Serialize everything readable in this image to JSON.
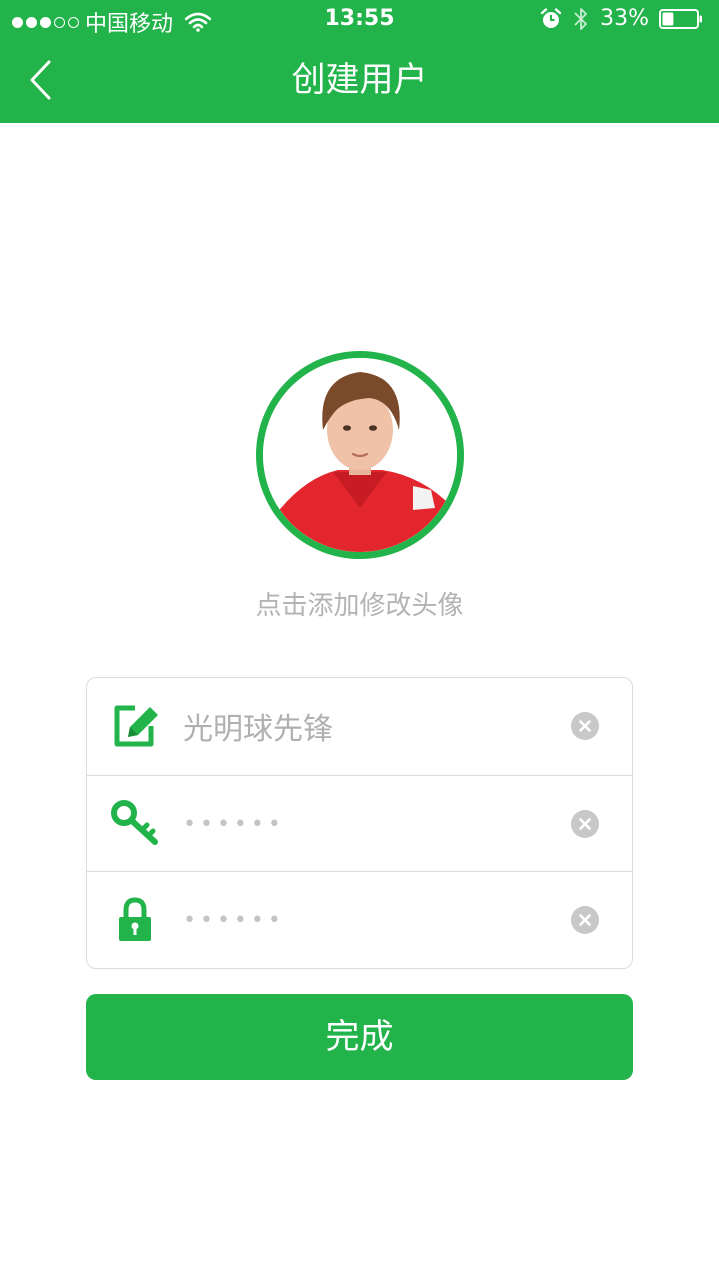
{
  "status_bar": {
    "signal_dots": [
      "full",
      "full",
      "full",
      "empty",
      "empty"
    ],
    "carrier": "中国移动",
    "time": "13:55",
    "battery": "33%",
    "battery_fraction": 0.33
  },
  "header": {
    "title": "创建用户",
    "background_color": "#22b34a"
  },
  "avatar": {
    "caption": "点击添加修改头像",
    "ring_color": "#22b34a"
  },
  "form": {
    "username_value": "光明球先锋",
    "password_value": "••••••",
    "confirm_password_value": "••••••"
  },
  "submit": {
    "label": "完成"
  },
  "icons": {
    "back": "chevron-left-icon",
    "username": "edit-icon",
    "password": "key-icon",
    "confirm": "lock-icon",
    "clear": "clear-circle-icon"
  }
}
